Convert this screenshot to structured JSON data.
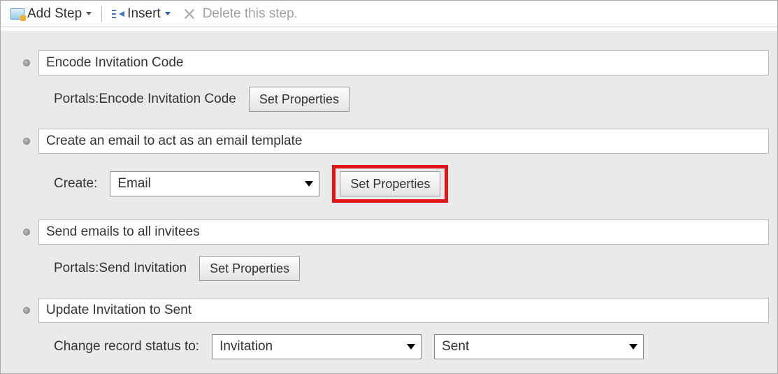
{
  "toolbar": {
    "add_step_label": "Add Step",
    "insert_label": "Insert",
    "delete_label": "Delete this step."
  },
  "steps": [
    {
      "title": "Encode Invitation Code",
      "detail_label": "Portals:Encode Invitation Code",
      "button_label": "Set Properties"
    },
    {
      "title": "Create an email to act as an email template",
      "create_label": "Create:",
      "create_value": "Email",
      "button_label": "Set Properties"
    },
    {
      "title": "Send emails to all invitees",
      "detail_label": "Portals:Send Invitation",
      "button_label": "Set Properties"
    },
    {
      "title": "Update Invitation to Sent",
      "change_label": "Change record status to:",
      "status_entity": "Invitation",
      "status_value": "Sent"
    }
  ]
}
